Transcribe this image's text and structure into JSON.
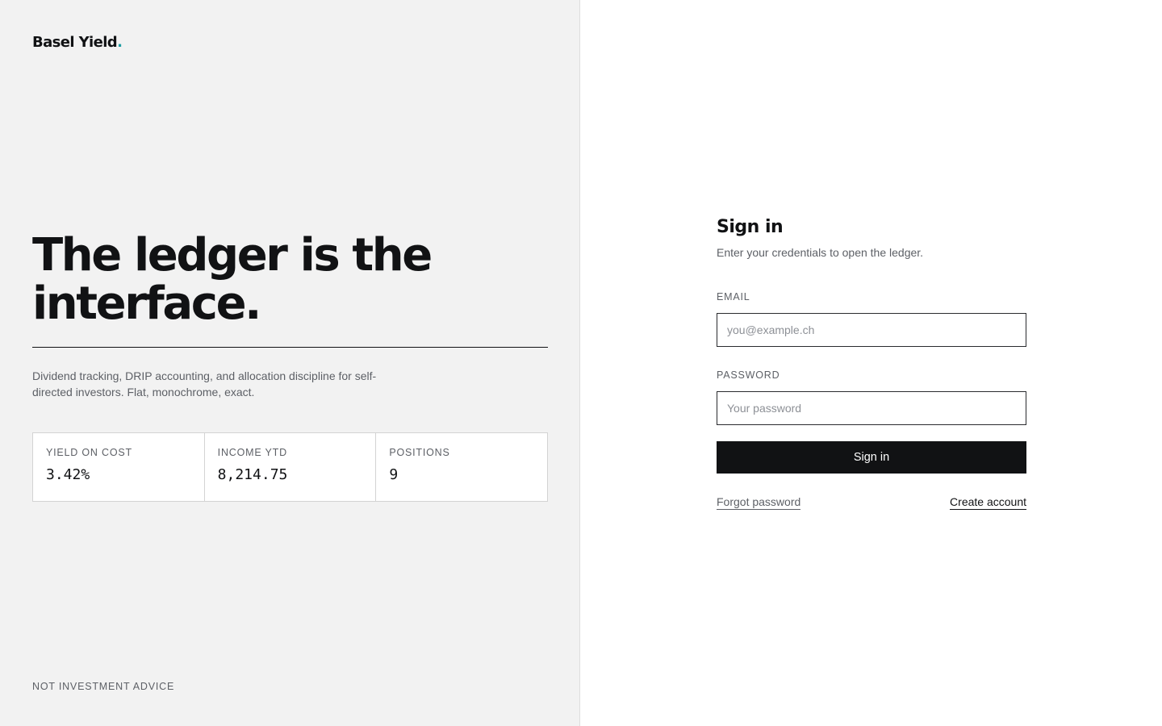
{
  "brand": {
    "name": "Basel Yield",
    "dot": ".",
    "accent_color": "#1f9ea3"
  },
  "hero": {
    "headline": "The ledger is the interface.",
    "description": "Dividend tracking, DRIP accounting, and allocation discipline for self-directed investors. Flat, monochrome, exact."
  },
  "stats": [
    {
      "label": "YIELD ON COST",
      "value": "3.42%"
    },
    {
      "label": "INCOME YTD",
      "value": "8,214.75"
    },
    {
      "label": "POSITIONS",
      "value": "9"
    }
  ],
  "disclaimer": "NOT INVESTMENT ADVICE",
  "signin": {
    "title": "Sign in",
    "subtitle": "Enter your credentials to open the ledger.",
    "email_label": "EMAIL",
    "email_placeholder": "you@example.ch",
    "email_value": "",
    "password_label": "PASSWORD",
    "password_placeholder": "Your password",
    "password_value": "",
    "submit_label": "Sign in",
    "forgot_label": "Forgot password",
    "create_label": "Create account"
  },
  "colors": {
    "ink": "#111214",
    "muted": "#5d6066",
    "panel_bg": "#f2f2f2"
  }
}
